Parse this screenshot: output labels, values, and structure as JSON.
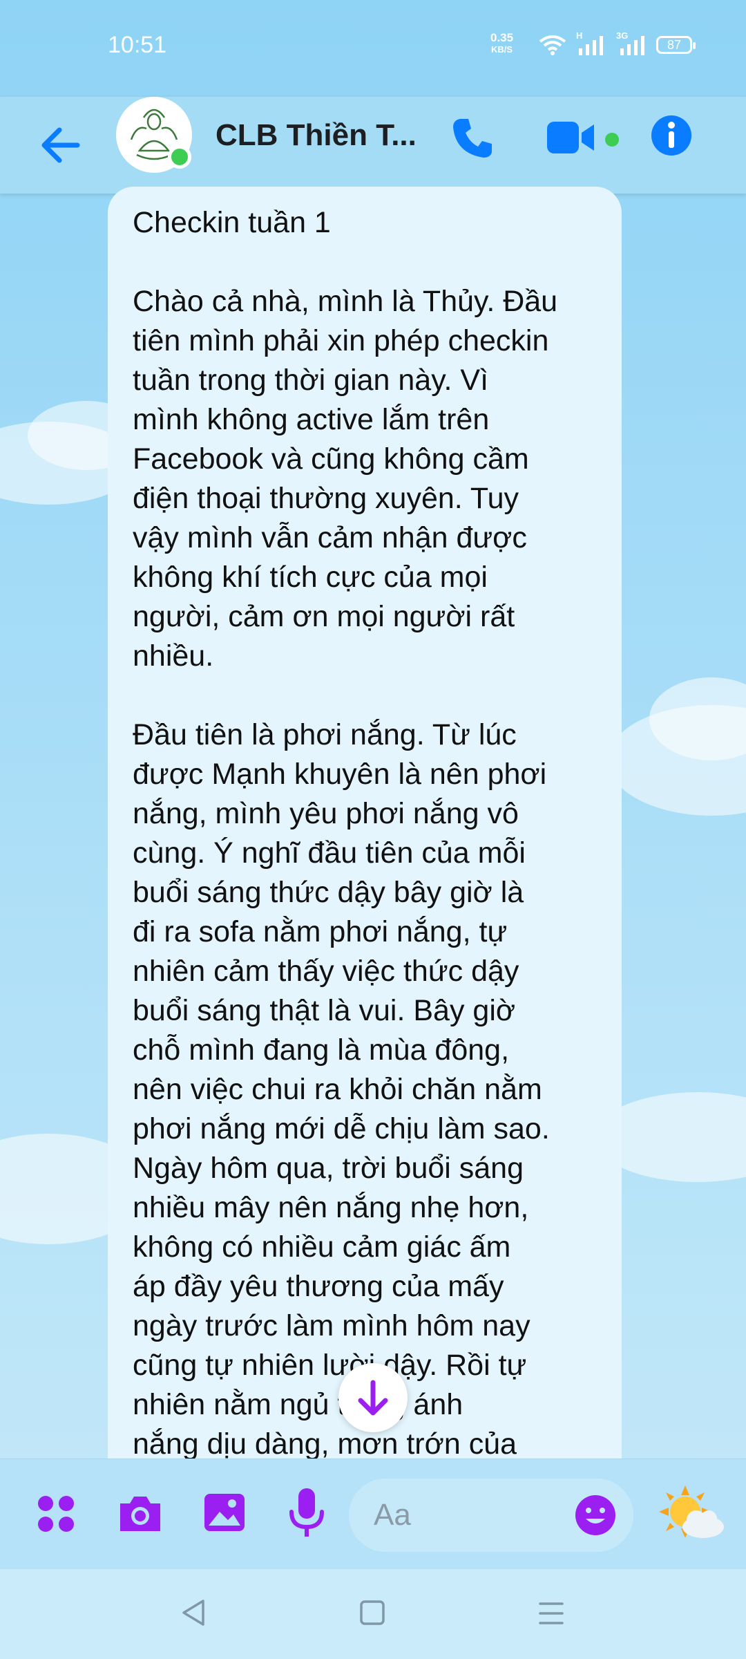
{
  "status_bar": {
    "time": "10:51",
    "net_speed_value": "0.35",
    "net_speed_unit": "KB/S",
    "signal1_label": "H",
    "signal2_label": "3G",
    "battery": "87"
  },
  "header": {
    "title": "CLB Thiền T...",
    "online": true,
    "accent_color": "#0a7cff",
    "online_color": "#3ccd52"
  },
  "message": {
    "text": "Checkin tuần 1\n\nChào cả nhà, mình là Thủy. Đầu\ntiên mình phải xin phép checkin\ntuần trong thời gian này. Vì\nmình không active lắm trên\nFacebook và cũng không cầm\nđiện thoại thường xuyên. Tuy\nvậy mình vẫn cảm nhận được\nkhông khí tích cực của mọi\nngười, cảm ơn mọi người rất\nnhiều.\n\nĐầu tiên là phơi nắng. Từ lúc\nđược Mạnh khuyên là nên phơi\nnắng, mình yêu phơi nắng vô\ncùng. Ý nghĩ đầu tiên của mỗi\nbuổi sáng thức dậy bây giờ là\nđi ra sofa nằm phơi nắng, tự\nnhiên cảm thấy việc thức dậy\nbuổi sáng thật là vui. Bây giờ\nchỗ mình đang là mùa đông,\nnên việc chui ra khỏi chăn nằm\nphơi nắng mới dễ chịu làm sao.\nNgày hôm qua, trời buổi sáng\nnhiều mây nên nắng nhẹ hơn,\nkhông có nhiều cảm giác ấm\náp đầy yêu thương của mấy\nngày trước làm mình hôm nay\ncũng tự nhiên lười dậy. Rồi tự\nnhiên nằm ngủ trong ánh\nnắng dịu dàng, mơn trớn của"
  },
  "composer": {
    "placeholder": "Aa",
    "icon_color": "#9b1ff0",
    "icons": [
      "apps-icon",
      "camera-icon",
      "gallery-icon",
      "microphone-icon",
      "emoji-icon",
      "weather-sticker-icon"
    ]
  },
  "nav": {
    "icons": [
      "back-triangle-icon",
      "home-square-icon",
      "menu-lines-icon"
    ]
  }
}
